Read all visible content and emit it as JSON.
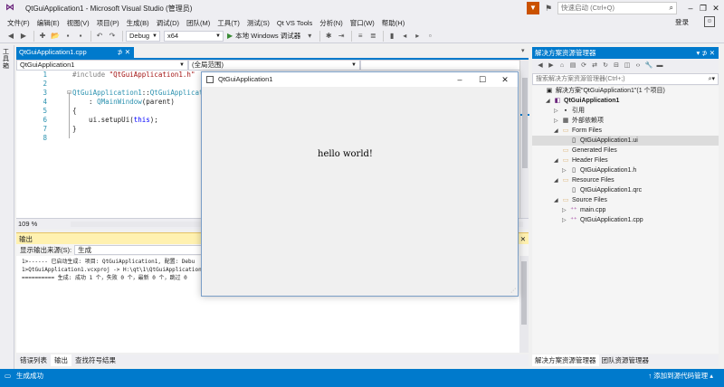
{
  "titlebar": {
    "title": "QtGuiApplication1 - Microsoft Visual Studio (管理员)",
    "quick_launch_placeholder": "快速启动 (Ctrl+Q)",
    "icons": [
      "vs-logo",
      "filter-icon",
      "flag-icon",
      "search-icon",
      "minimize-icon",
      "restore-icon",
      "close-icon"
    ]
  },
  "menu": {
    "items": [
      "文件(F)",
      "编辑(E)",
      "视图(V)",
      "项目(P)",
      "生成(B)",
      "调试(D)",
      "团队(M)",
      "工具(T)",
      "测试(S)",
      "Qt VS Tools",
      "分析(N)",
      "窗口(W)",
      "帮助(H)"
    ],
    "login": "登录"
  },
  "toolbar": {
    "config": "Debug",
    "platform": "x64",
    "run_label": "本地 Windows 调试器"
  },
  "toolbox": {
    "label": "工具箱"
  },
  "editor": {
    "tab_title": "QtGuiApplication1.cpp",
    "nav_project": "QtGuiApplication1",
    "nav_scope": "(全局范围)",
    "nav_member": "",
    "zoom": "109 %",
    "lines": [
      {
        "n": "1",
        "segments": [
          [
            "pp",
            "#include "
          ],
          [
            "str",
            "\"QtGuiApplication1.h\""
          ]
        ]
      },
      {
        "n": "2",
        "segments": []
      },
      {
        "n": "3",
        "segments": [
          [
            "cls",
            "QtGuiApplication1"
          ],
          [
            "",
            "::"
          ],
          [
            "cls",
            "QtGuiApplication1"
          ],
          [
            "",
            "(QWidget "
          ]
        ]
      },
      {
        "n": "4",
        "segments": [
          [
            "",
            "    : "
          ],
          [
            "cls",
            "QMainWindow"
          ],
          [
            "",
            "(parent)"
          ]
        ]
      },
      {
        "n": "5",
        "segments": [
          [
            "",
            "{"
          ]
        ]
      },
      {
        "n": "6",
        "segments": [
          [
            "",
            "    ui.setupUi("
          ],
          [
            "kw",
            "this"
          ],
          [
            "",
            ");"
          ]
        ]
      },
      {
        "n": "7",
        "segments": [
          [
            "",
            "}"
          ]
        ]
      },
      {
        "n": "8",
        "segments": []
      }
    ]
  },
  "output": {
    "title": "输出",
    "source_label": "显示输出来源(S):",
    "source_value": "生成",
    "lines": [
      "1>------ 已启动生成: 项目: QtGuiApplication1, 配置: Debu",
      "1>QtGuiApplication1.vcxproj -> H:\\qt\\1\\QtGuiApplication1",
      "========== 生成: 成功 1 个，失败 0 个，最新 0 个，跳过 0"
    ]
  },
  "bottom_tabs": [
    "错误列表",
    "输出",
    "查找符号结果"
  ],
  "solution_explorer": {
    "title": "解决方案资源管理器",
    "header_controls": "▾ ⊅ ✕",
    "search_placeholder": "搜索解决方案资源管理器(Ctrl+;)",
    "tree": [
      {
        "label": "解决方案\"QtGuiApplication1\"(1 个项目)",
        "indent": 0,
        "icon": "solution-icon",
        "glyph": "▣",
        "exp": ""
      },
      {
        "label": "QtGuiApplication1",
        "indent": 1,
        "icon": "project-icon",
        "glyph": "◧",
        "exp": "◢",
        "bold": true
      },
      {
        "label": "引用",
        "indent": 2,
        "icon": "references-icon",
        "glyph": "▪",
        "exp": "▷"
      },
      {
        "label": "外部依赖项",
        "indent": 2,
        "icon": "external-deps-icon",
        "glyph": "▦",
        "exp": "▷"
      },
      {
        "label": "Form Files",
        "indent": 2,
        "icon": "folder-icon",
        "glyph": "▭",
        "exp": "◢"
      },
      {
        "label": "QtGuiApplication1.ui",
        "indent": 3,
        "icon": "ui-file-icon",
        "glyph": "▯",
        "exp": "",
        "selected": true
      },
      {
        "label": "Generated Files",
        "indent": 2,
        "icon": "folder-icon",
        "glyph": "▭",
        "exp": ""
      },
      {
        "label": "Header Files",
        "indent": 2,
        "icon": "folder-icon",
        "glyph": "▭",
        "exp": "◢"
      },
      {
        "label": "QtGuiApplication1.h",
        "indent": 3,
        "icon": "header-file-icon",
        "glyph": "▯",
        "exp": "▷"
      },
      {
        "label": "Resource Files",
        "indent": 2,
        "icon": "folder-icon",
        "glyph": "▭",
        "exp": "◢"
      },
      {
        "label": "QtGuiApplication1.qrc",
        "indent": 3,
        "icon": "resource-file-icon",
        "glyph": "▯",
        "exp": ""
      },
      {
        "label": "Source Files",
        "indent": 2,
        "icon": "folder-icon",
        "glyph": "▭",
        "exp": "◢"
      },
      {
        "label": "main.cpp",
        "indent": 3,
        "icon": "cpp-file-icon",
        "glyph": "⁺⁺",
        "exp": "▷"
      },
      {
        "label": "QtGuiApplication1.cpp",
        "indent": 3,
        "icon": "cpp-file-icon",
        "glyph": "⁺⁺",
        "exp": "▷"
      }
    ],
    "bottom_tabs": [
      "解决方案资源管理器",
      "团队资源管理器"
    ]
  },
  "statusbar": {
    "message": "生成成功",
    "right": "↑ 添加到源代码管理 ▴"
  },
  "qt_app": {
    "title": "QtGuiApplication1",
    "body_text": "hello world!"
  },
  "colors": {
    "accent": "#007acc",
    "output_header": "#fff1b0",
    "chrome": "#eeeef2",
    "filter": "#ca5100"
  }
}
